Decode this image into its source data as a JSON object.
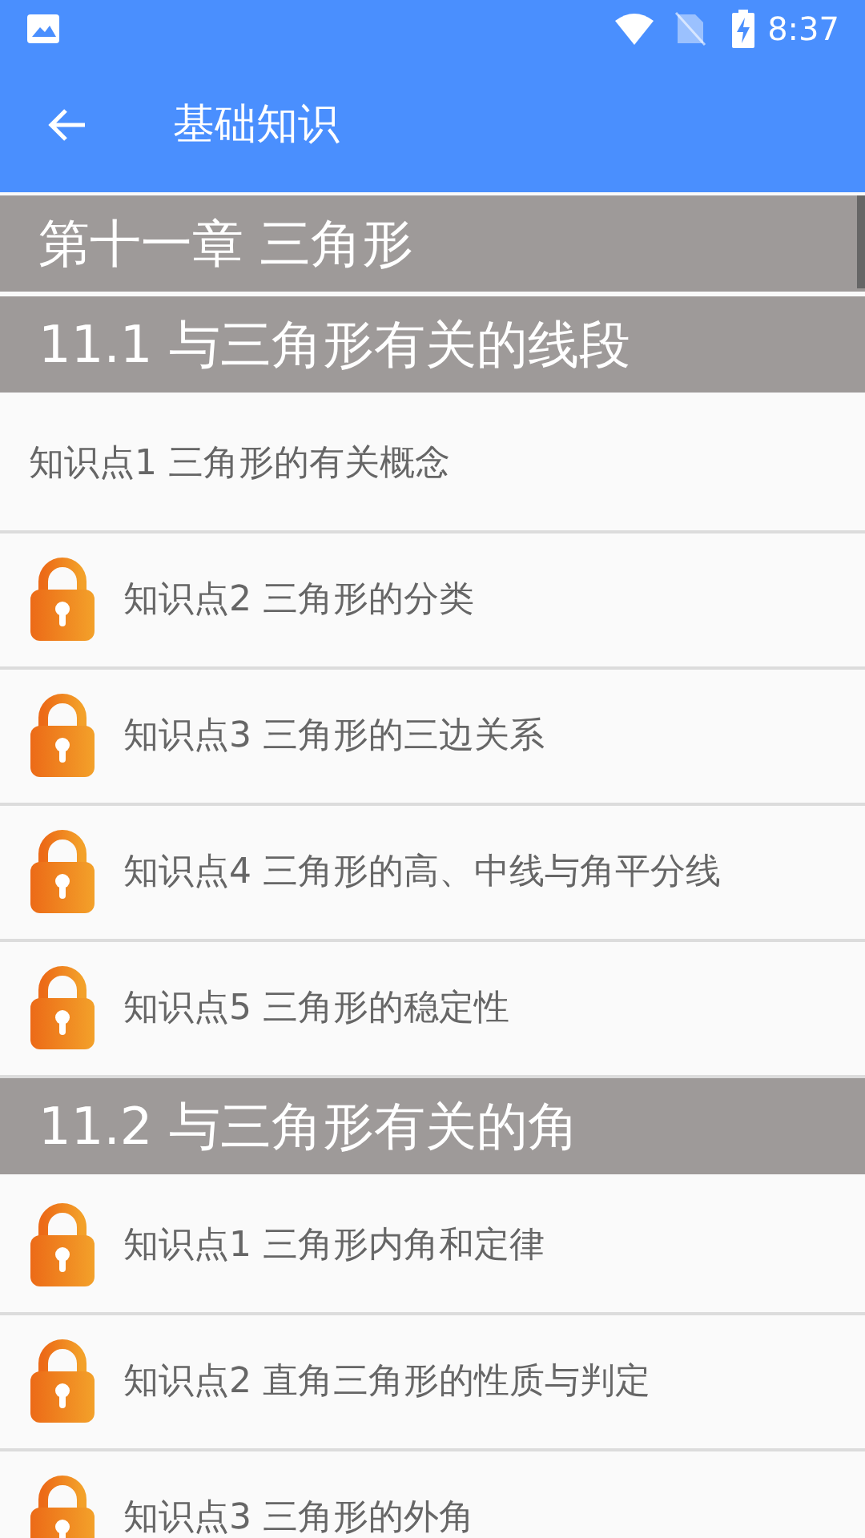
{
  "status_bar": {
    "time": "8:37"
  },
  "app_bar": {
    "title": "基础知识"
  },
  "rows": [
    {
      "kind": "chapter",
      "label": "第十一章 三角形"
    },
    {
      "kind": "section",
      "label": "11.1 与三角形有关的线段"
    },
    {
      "kind": "item",
      "label": "知识点1 三角形的有关概念",
      "locked": false
    },
    {
      "kind": "item",
      "label": "知识点2 三角形的分类",
      "locked": true
    },
    {
      "kind": "item",
      "label": "知识点3 三角形的三边关系",
      "locked": true
    },
    {
      "kind": "item",
      "label": "知识点4 三角形的高、中线与角平分线",
      "locked": true
    },
    {
      "kind": "item",
      "label": "知识点5 三角形的稳定性",
      "locked": true
    },
    {
      "kind": "section",
      "label": "11.2 与三角形有关的角"
    },
    {
      "kind": "item",
      "label": "知识点1 三角形内角和定律",
      "locked": true
    },
    {
      "kind": "item",
      "label": "知识点2 直角三角形的性质与判定",
      "locked": true
    },
    {
      "kind": "item",
      "label": "知识点3 三角形的外角",
      "locked": true
    }
  ]
}
